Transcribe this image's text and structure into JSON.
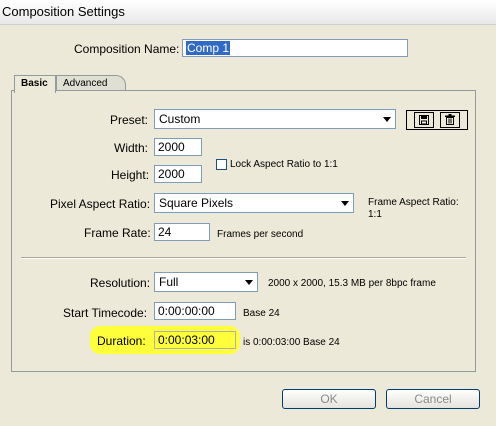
{
  "window": {
    "title": "Composition Settings"
  },
  "composition_name": {
    "label": "Composition Name:",
    "value": "Comp 1"
  },
  "tabs": [
    {
      "label": "Basic"
    },
    {
      "label": "Advanced"
    }
  ],
  "preset": {
    "label": "Preset:",
    "value": "Custom",
    "save_icon": "save-icon",
    "delete_icon": "trash-icon"
  },
  "width": {
    "label": "Width:",
    "value": "2000"
  },
  "height": {
    "label": "Height:",
    "value": "2000"
  },
  "lock_aspect": {
    "label": "Lock Aspect Ratio to 1:1",
    "checked": false
  },
  "pixel_aspect": {
    "label": "Pixel Aspect Ratio:",
    "value": "Square Pixels"
  },
  "frame_aspect": {
    "label": "Frame Aspect Ratio:",
    "value": "1:1"
  },
  "frame_rate": {
    "label": "Frame Rate:",
    "value": "24",
    "unit": "Frames per second"
  },
  "resolution": {
    "label": "Resolution:",
    "value": "Full",
    "info": "2000 x 2000, 15.3 MB per 8bpc frame"
  },
  "start_timecode": {
    "label": "Start Timecode:",
    "value": "0:00:00:00",
    "base": "Base 24"
  },
  "duration": {
    "label": "Duration:",
    "value": "0:00:03:00",
    "info": "is 0:00:03:00  Base 24",
    "highlight_color": "#ffff33"
  },
  "buttons": {
    "ok": "OK",
    "cancel": "Cancel"
  }
}
